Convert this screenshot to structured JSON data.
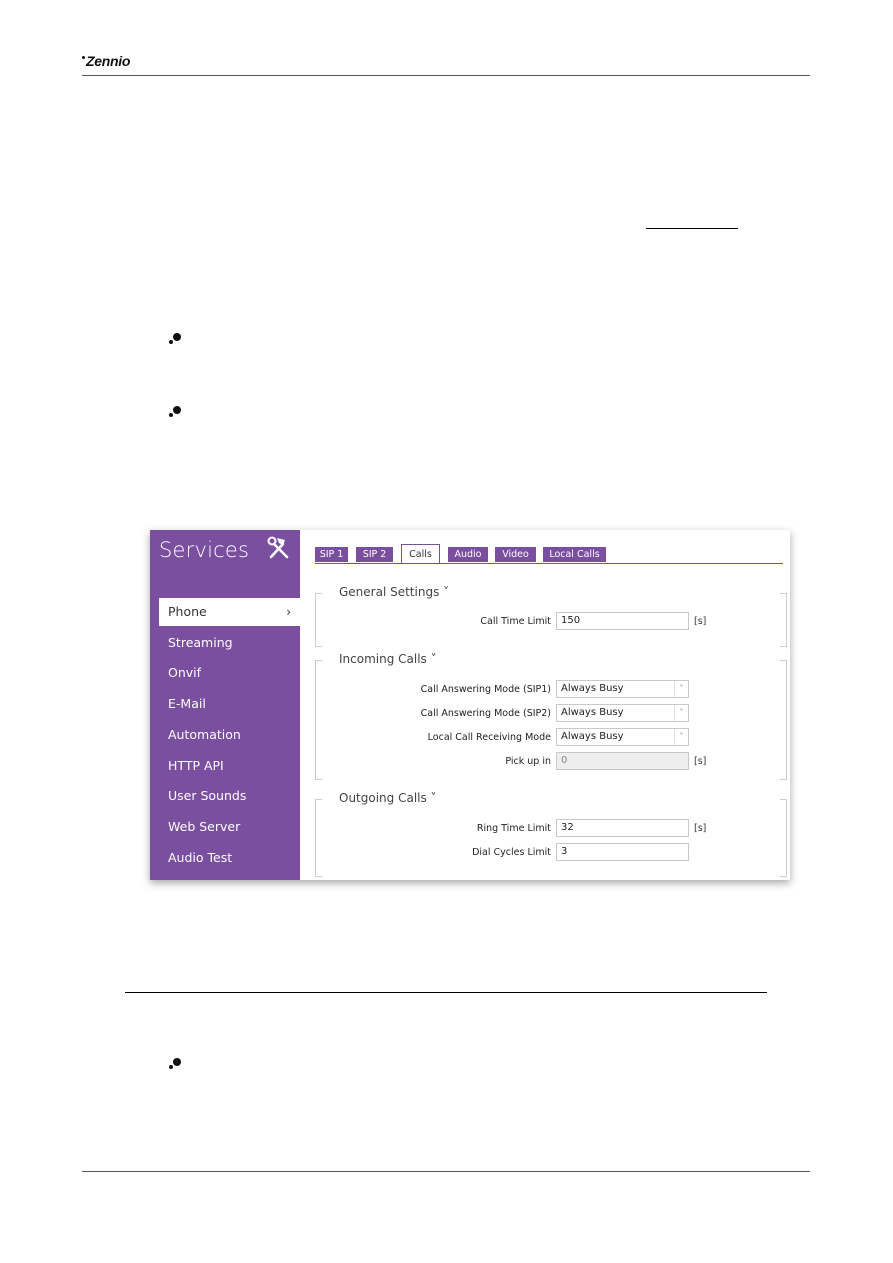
{
  "header": {
    "brand": "Zennio"
  },
  "screenshot": {
    "sidebar": {
      "title": "Services",
      "title_icon": "tools-icon",
      "items": [
        {
          "label": "Phone",
          "active": true,
          "chevron": "›"
        },
        {
          "label": "Streaming"
        },
        {
          "label": "Onvif"
        },
        {
          "label": "E-Mail"
        },
        {
          "label": "Automation"
        },
        {
          "label": "HTTP API"
        },
        {
          "label": "User Sounds"
        },
        {
          "label": "Web Server"
        },
        {
          "label": "Audio Test"
        }
      ]
    },
    "tabs": [
      {
        "label": "SIP 1"
      },
      {
        "label": "SIP 2"
      },
      {
        "label": "Calls",
        "active": true
      },
      {
        "label": "Audio"
      },
      {
        "label": "Video"
      },
      {
        "label": "Local Calls"
      }
    ],
    "groups": {
      "general": {
        "title": "General Settings ˅",
        "rows": [
          {
            "label": "Call Time Limit",
            "value": "150",
            "unit": "[s]"
          }
        ]
      },
      "incoming": {
        "title": "Incoming Calls ˅",
        "rows": [
          {
            "label": "Call Answering Mode (SIP1)",
            "value": "Always Busy",
            "arrow": "˅"
          },
          {
            "label": "Call Answering Mode (SIP2)",
            "value": "Always Busy",
            "arrow": "˅"
          },
          {
            "label": "Local Call Receiving Mode",
            "value": "Always Busy",
            "arrow": "˅"
          },
          {
            "label": "Pick up in",
            "value": "0",
            "unit": "[s]"
          }
        ]
      },
      "outgoing": {
        "title": "Outgoing Calls ˅",
        "rows": [
          {
            "label": "Ring Time Limit",
            "value": "32",
            "unit": "[s]"
          },
          {
            "label": "Dial Cycles Limit",
            "value": "3"
          }
        ]
      }
    },
    "colors": {
      "accent": "#7b4fa0"
    }
  }
}
